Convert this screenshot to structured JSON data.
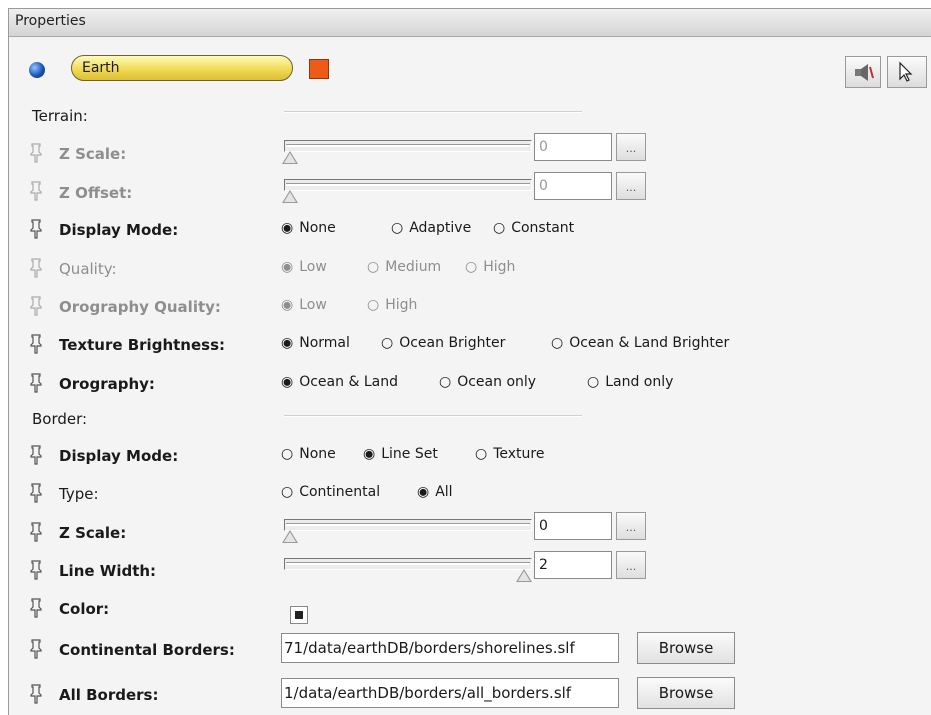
{
  "window": {
    "title": "Properties"
  },
  "layer": {
    "name": "Earth",
    "color": "#ee5a17"
  },
  "sections": {
    "terrain": "Terrain:",
    "border": "Border:"
  },
  "terrain": {
    "z_scale": {
      "label": "Z Scale:",
      "value": "0",
      "level": 0,
      "button": "..."
    },
    "z_offset": {
      "label": "Z Offset:",
      "value": "0",
      "level": 0,
      "button": "..."
    },
    "display_mode": {
      "label": "Display Mode:",
      "options": [
        "None",
        "Adaptive",
        "Constant"
      ],
      "selected": "None"
    },
    "quality": {
      "label": "Quality:",
      "options": [
        "Low",
        "Medium",
        "High"
      ],
      "selected": "Low"
    },
    "orography_quality": {
      "label": "Orography Quality:",
      "options": [
        "Low",
        "High"
      ],
      "selected": "Low"
    },
    "texture_brightness": {
      "label": "Texture Brightness:",
      "options": [
        "Normal",
        "Ocean Brighter",
        "Ocean & Land Brighter"
      ],
      "selected": "Normal"
    },
    "orography": {
      "label": "Orography:",
      "options": [
        "Ocean & Land",
        "Ocean only",
        "Land only"
      ],
      "selected": "Ocean & Land"
    }
  },
  "border": {
    "display_mode": {
      "label": "Display Mode:",
      "options": [
        "None",
        "Line Set",
        "Texture"
      ],
      "selected": "Line Set"
    },
    "type": {
      "label": "Type:",
      "options": [
        "Continental",
        "All"
      ],
      "selected": "All"
    },
    "z_scale": {
      "label": "Z Scale:",
      "value": "0",
      "level": 0,
      "button": "..."
    },
    "line_width": {
      "label": "Line Width:",
      "value": "2",
      "level": 1,
      "button": "..."
    },
    "color": {
      "label": "Color:"
    },
    "continental_borders": {
      "label": "Continental Borders:",
      "value": "71/data/earthDB/borders/shorelines.slf",
      "button": "Browse"
    },
    "all_borders": {
      "label": "All Borders:",
      "value": "1/data/earthDB/borders/all_borders.slf",
      "button": "Browse"
    }
  },
  "glyphs": {
    "radio_on": "◉",
    "radio_off": "○"
  },
  "icons": [
    "globe-icon",
    "pin-icon",
    "speaker-icon",
    "pointer-icon"
  ]
}
